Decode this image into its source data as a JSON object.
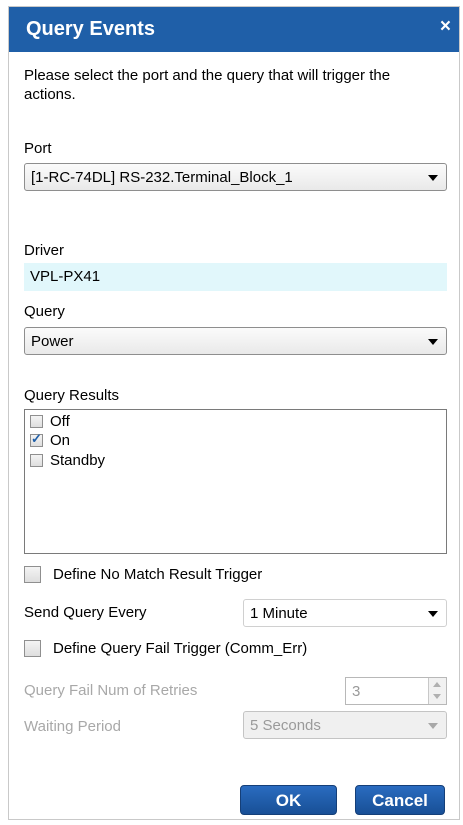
{
  "dialog": {
    "title": "Query Events",
    "close_glyph": "×",
    "instruction": "Please select the port and the query that will trigger the actions."
  },
  "port": {
    "label": "Port",
    "value": "[1-RC-74DL] RS-232.Terminal_Block_1"
  },
  "driver": {
    "label": "Driver",
    "value": "VPL-PX41"
  },
  "query": {
    "label": "Query",
    "value": "Power"
  },
  "results": {
    "label": "Query Results",
    "items": [
      {
        "label": "Off",
        "checked": false
      },
      {
        "label": "On",
        "checked": true
      },
      {
        "label": "Standby",
        "checked": false
      }
    ]
  },
  "no_match": {
    "label": "Define No Match Result Trigger",
    "checked": false
  },
  "send_query": {
    "label": "Send Query Every",
    "value": "1 Minute"
  },
  "query_fail": {
    "label": "Define Query Fail Trigger (Comm_Err)",
    "checked": false
  },
  "retries": {
    "label": "Query Fail Num of Retries",
    "value": "3"
  },
  "waiting": {
    "label": "Waiting Period",
    "value": "5 Seconds"
  },
  "buttons": {
    "ok": "OK",
    "cancel": "Cancel"
  },
  "colors": {
    "titlebar": "#1f5fa8",
    "button": "#1f5fa8",
    "driver_bg": "#e1f7fb"
  }
}
